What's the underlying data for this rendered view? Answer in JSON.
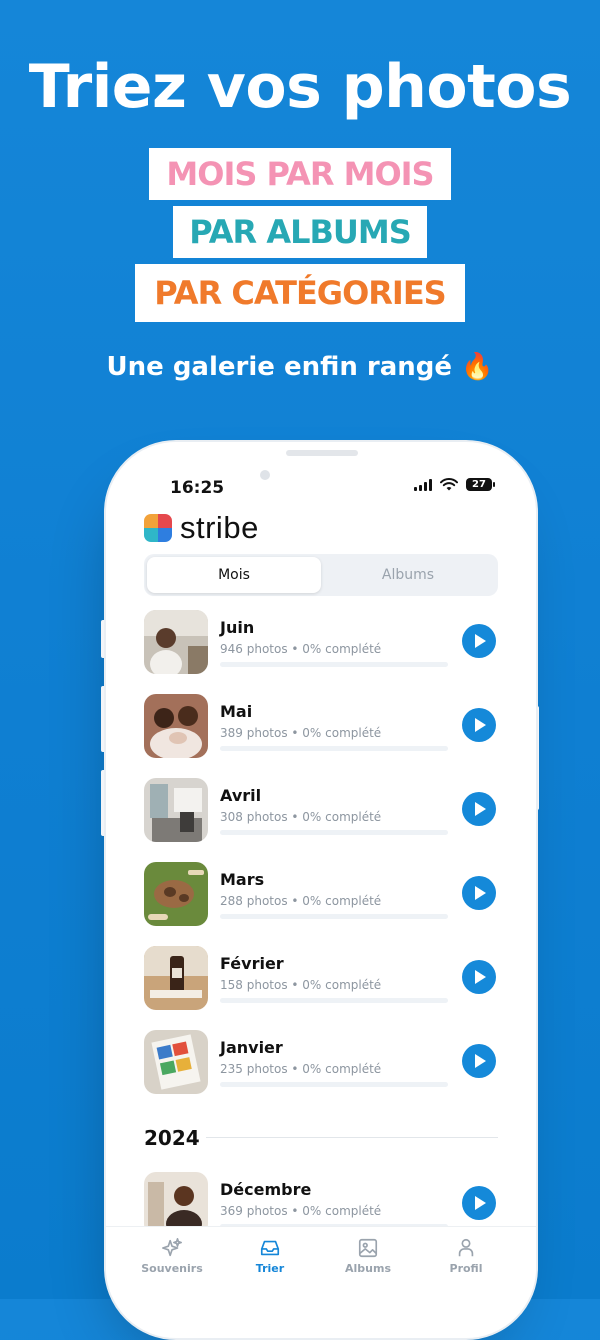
{
  "promo": {
    "headline": "Triez vos photos",
    "pills": [
      "MOIS PAR MOIS",
      "PAR ALBUMS",
      "PAR CATÉGORIES"
    ],
    "tagline": "Une galerie enfin rangé 🔥"
  },
  "status_bar": {
    "time": "16:25",
    "battery": "27"
  },
  "app": {
    "name": "stribe"
  },
  "segments": {
    "active": "Mois",
    "inactive": "Albums"
  },
  "months": [
    {
      "name": "Juin",
      "meta": "946 photos • 0% complété",
      "progress": 0
    },
    {
      "name": "Mai",
      "meta": "389 photos • 0% complété",
      "progress": 0
    },
    {
      "name": "Avril",
      "meta": "308 photos • 0% complété",
      "progress": 0
    },
    {
      "name": "Mars",
      "meta": "288 photos • 0% complété",
      "progress": 0
    },
    {
      "name": "Février",
      "meta": "158 photos • 0% complété",
      "progress": 0
    },
    {
      "name": "Janvier",
      "meta": "235 photos • 0% complété",
      "progress": 0
    }
  ],
  "year_2024": {
    "label": "2024",
    "months": [
      {
        "name": "Décembre",
        "meta": "369 photos • 0% complété",
        "progress": 0
      }
    ]
  },
  "tabs": [
    {
      "label": "Souvenirs",
      "icon": "sparkles-icon"
    },
    {
      "label": "Trier",
      "icon": "inbox-icon",
      "active": true
    },
    {
      "label": "Albums",
      "icon": "image-icon"
    },
    {
      "label": "Profil",
      "icon": "user-icon"
    }
  ],
  "colors": {
    "background": "#1586d8",
    "pill_pink": "#f493b4",
    "pill_teal": "#27a8b4",
    "pill_orange": "#f07a2b",
    "accent": "#1589d9"
  }
}
